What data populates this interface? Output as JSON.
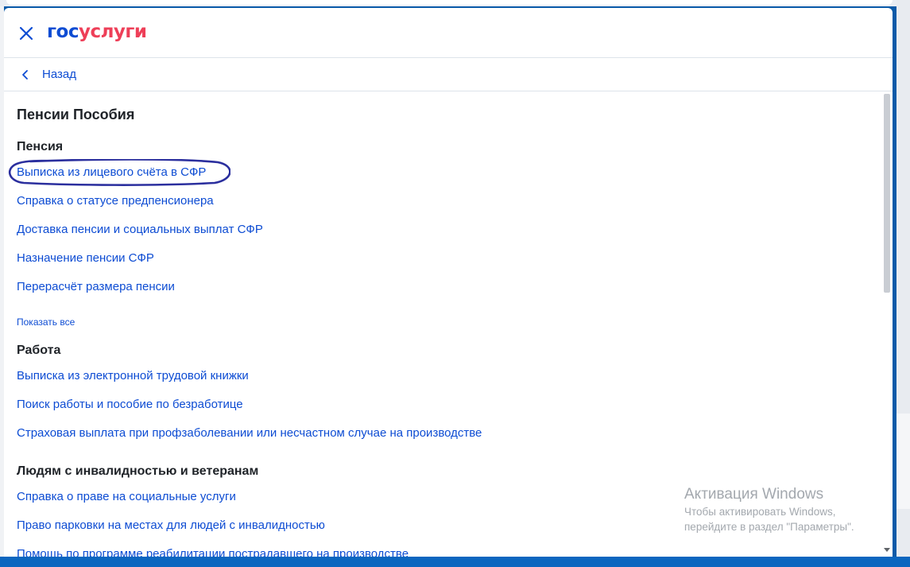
{
  "header": {
    "logo_part1": "гос",
    "logo_part2": "услуги",
    "brand_blue": "#0d4cd3",
    "brand_red": "#ee3f58"
  },
  "nav": {
    "back_label": "Назад"
  },
  "page": {
    "title": "Пенсии Пособия"
  },
  "sections": [
    {
      "title": "Пенсия",
      "links": [
        "Выписка из лицевого счёта в СФР",
        "Справка о статусе предпенсионера",
        "Доставка пенсии и социальных выплат СФР",
        "Назначение пенсии СФР",
        "Перерасчёт размера пенсии"
      ],
      "show_all": "Показать все"
    },
    {
      "title": "Работа",
      "links": [
        "Выписка из электронной трудовой книжки",
        "Поиск работы и пособие по безработице",
        "Страховая выплата при профзаболевании или несчастном случае на производстве"
      ]
    },
    {
      "title": "Людям с инвалидностью и ветеранам",
      "links": [
        "Справка о праве на социальные услуги",
        "Право парковки на местах для людей с инвалидностью",
        "Помощь по программе реабилитации пострадавшего на производстве"
      ]
    }
  ],
  "watermark": {
    "title": "Активация Windows",
    "line1": "Чтобы активировать Windows,",
    "line2": "перейдите в раздел \"Параметры\"."
  },
  "annotation_color": "#2b2f9e"
}
